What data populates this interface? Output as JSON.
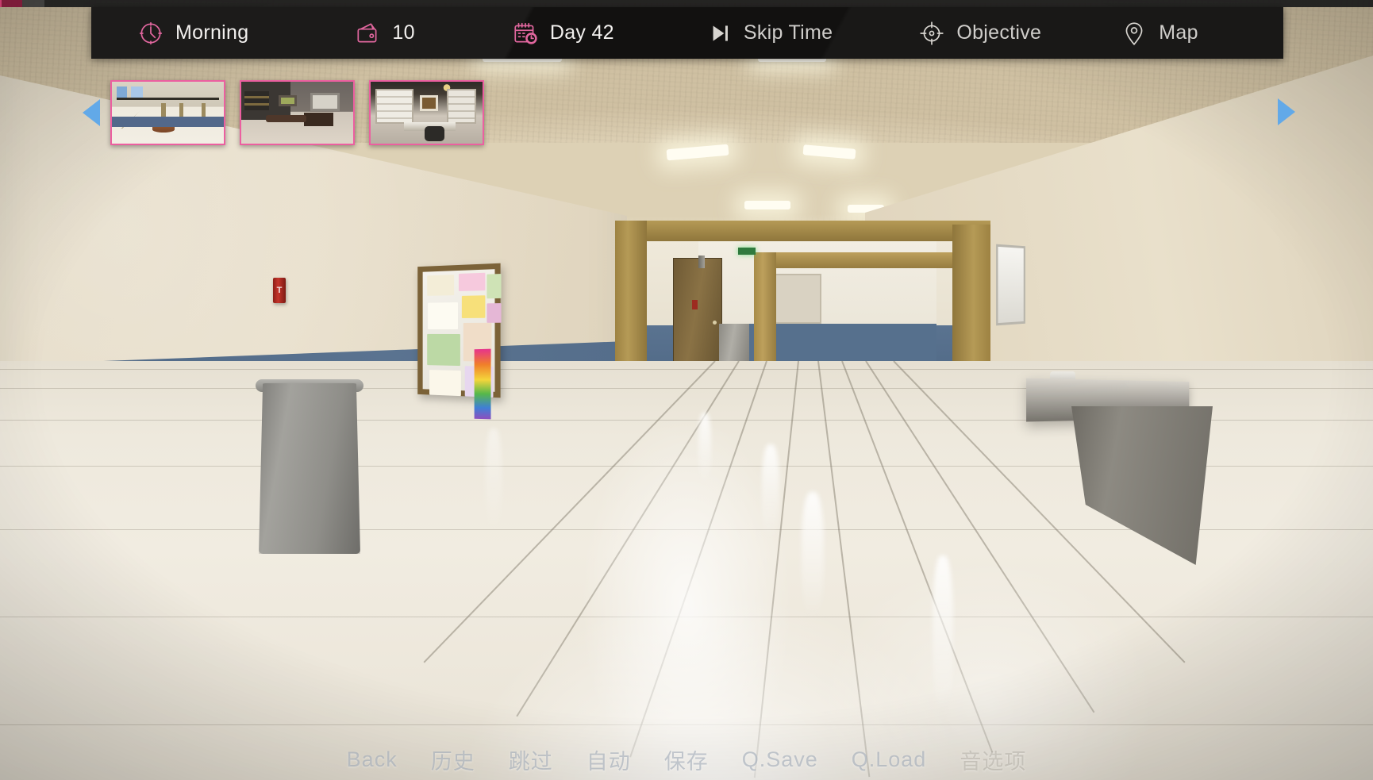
{
  "hud": {
    "items": [
      {
        "id": "time-of-day",
        "icon": "clock-icon",
        "label": "Morning",
        "icon_color": "#e2679f"
      },
      {
        "id": "money",
        "icon": "wallet-icon",
        "label": "10",
        "icon_color": "#e2679f"
      },
      {
        "id": "day-counter",
        "icon": "calendar-icon",
        "label": "Day 42",
        "icon_color": "#e2679f"
      },
      {
        "id": "skip-time",
        "icon": "skip-icon",
        "label": "Skip Time",
        "icon_color": "#d8d5d0"
      },
      {
        "id": "objective",
        "icon": "target-icon",
        "label": "Objective",
        "icon_color": "#d8d5d0"
      },
      {
        "id": "map",
        "icon": "map-pin-icon",
        "label": "Map",
        "icon_color": "#d8d5d0"
      }
    ],
    "bar_color": "#121110"
  },
  "location_selector": {
    "prev_arrow": "left-arrow-icon",
    "next_arrow": "right-arrow-icon",
    "arrow_color": "#62a9e8",
    "border_color": "#ec5fa0",
    "thumbnails": [
      {
        "id": "thumb-1",
        "name": "school-atrium"
      },
      {
        "id": "thumb-2",
        "name": "dining-room"
      },
      {
        "id": "thumb-3",
        "name": "study-office"
      }
    ]
  },
  "bottom_menu": {
    "items": [
      {
        "id": "back",
        "label": "Back"
      },
      {
        "id": "history",
        "label": "历史"
      },
      {
        "id": "skip",
        "label": "跳过"
      },
      {
        "id": "auto",
        "label": "自动"
      },
      {
        "id": "save",
        "label": "保存"
      },
      {
        "id": "qsave",
        "label": "Q.Save"
      },
      {
        "id": "qload",
        "label": "Q.Load"
      },
      {
        "id": "options",
        "label": "音选项"
      }
    ]
  },
  "scene": {
    "name": "school-hallway",
    "wall_upper_color": "#e4dac4",
    "wall_lower_color": "#556e8b",
    "floor_color": "#efeade",
    "trim_color": "#a78b48"
  }
}
